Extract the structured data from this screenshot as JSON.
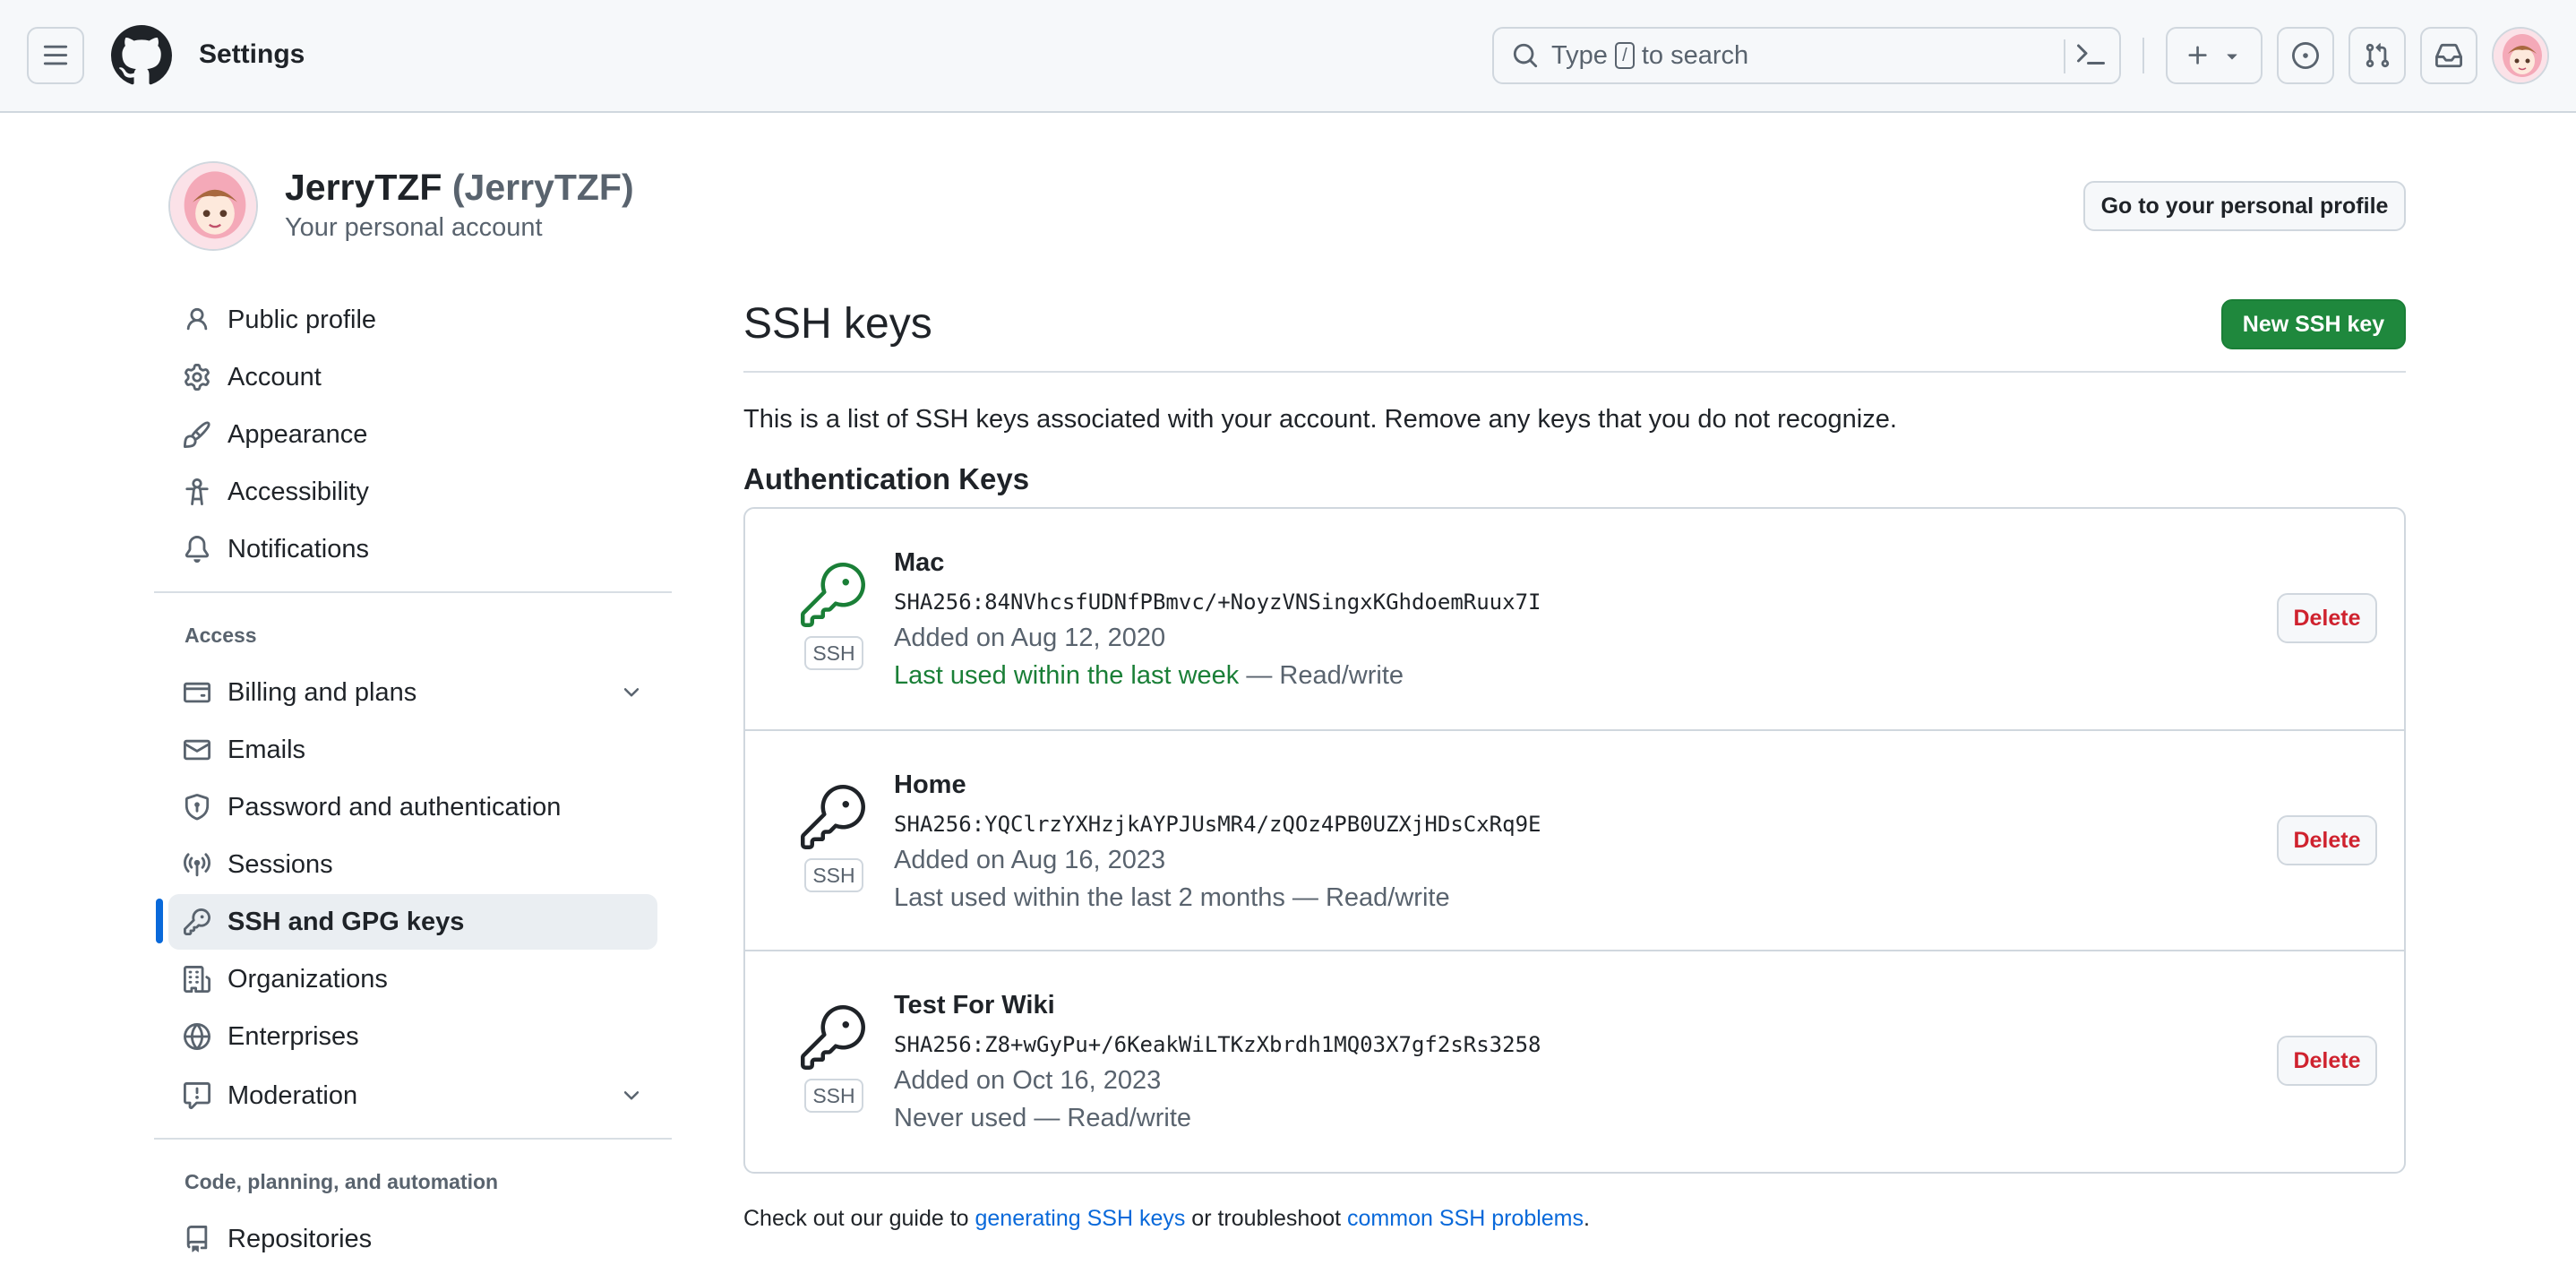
{
  "header": {
    "title": "Settings",
    "search_prefix": "Type",
    "search_key": "/",
    "search_suffix": "to search"
  },
  "account": {
    "name": "JerryTZF",
    "handle": "(JerryTZF)",
    "subtitle": "Your personal account",
    "profile_button": "Go to your personal profile"
  },
  "sidebar": {
    "items": [
      {
        "label": "Public profile",
        "icon": "person-icon"
      },
      {
        "label": "Account",
        "icon": "gear-icon"
      },
      {
        "label": "Appearance",
        "icon": "paintbrush-icon"
      },
      {
        "label": "Accessibility",
        "icon": "accessibility-icon"
      },
      {
        "label": "Notifications",
        "icon": "bell-icon"
      }
    ],
    "access_heading": "Access",
    "access_items": [
      {
        "label": "Billing and plans",
        "icon": "credit-card-icon"
      },
      {
        "label": "Emails",
        "icon": "mail-icon"
      },
      {
        "label": "Password and authentication",
        "icon": "shield-icon"
      },
      {
        "label": "Sessions",
        "icon": "broadcast-icon"
      },
      {
        "label": "SSH and GPG keys",
        "icon": "key-icon",
        "active": true
      },
      {
        "label": "Organizations",
        "icon": "organization-icon"
      },
      {
        "label": "Enterprises",
        "icon": "globe-icon"
      },
      {
        "label": "Moderation",
        "icon": "report-icon"
      }
    ],
    "code_heading": "Code, planning, and automation",
    "code_items": [
      {
        "label": "Repositories",
        "icon": "repo-icon"
      }
    ]
  },
  "main": {
    "title": "SSH keys",
    "new_key_button": "New SSH key",
    "description": "This is a list of SSH keys associated with your account. Remove any keys that you do not recognize.",
    "section_title": "Authentication Keys",
    "badge": "SSH",
    "delete_label": "Delete",
    "keys": [
      {
        "title": "Mac",
        "fingerprint": "SHA256:84NVhcsfUDNfPBmvc/+NoyzVNSingxKGhdoemRuux7I",
        "added": "Added on Aug 12, 2020",
        "last_used": "Last used within the last week",
        "access": " — Read/write",
        "recent": true,
        "icon_color": "#1a7f37"
      },
      {
        "title": "Home",
        "fingerprint": "SHA256:YQClrzYXHzjkAYPJUsMR4/zQOz4PB0UZXjHDsCxRq9E",
        "added": "Added on Aug 16, 2023",
        "last_used": "Last used within the last 2 months",
        "access": " — Read/write",
        "recent": false,
        "icon_color": "#1f2328"
      },
      {
        "title": "Test For Wiki",
        "fingerprint": "SHA256:Z8+wGyPu+/6KeakWiLTKzXbrdh1MQ03X7gf2sRs3258",
        "added": "Added on Oct 16, 2023",
        "last_used": "Never used",
        "access": " — Read/write",
        "recent": false,
        "icon_color": "#1f2328"
      }
    ],
    "guide": {
      "prefix": "Check out our guide to ",
      "link1": "generating SSH keys",
      "middle": " or troubleshoot ",
      "link2": "common SSH problems",
      "suffix": "."
    }
  },
  "colors": {
    "accent": "#0969da",
    "primary_button": "#1f883d",
    "danger": "#cf222e",
    "recent_green": "#1a7f37"
  }
}
